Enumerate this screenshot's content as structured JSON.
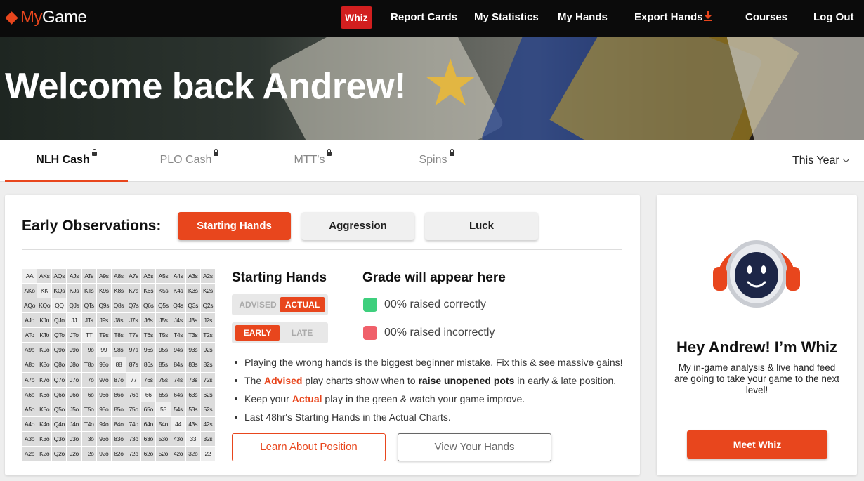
{
  "brand": {
    "logo_mark": "diamond-icon",
    "name_prefix": "My",
    "name_suffix": "Game",
    "accent_color": "#e8461d"
  },
  "nav": {
    "whiz": "Whiz",
    "report_cards": "Report Cards",
    "my_statistics": "My Statistics",
    "my_hands": "My Hands",
    "export_hands": "Export Hands",
    "export_icon": "download-icon",
    "courses": "Courses",
    "log_out": "Log Out"
  },
  "hero": {
    "title": "Welcome back Andrew!"
  },
  "tabs": [
    {
      "label": "NLH Cash",
      "active": true,
      "locked": true
    },
    {
      "label": "PLO Cash",
      "active": false,
      "locked": true
    },
    {
      "label": "MTT's",
      "active": false,
      "locked": true
    },
    {
      "label": "Spins",
      "active": false,
      "locked": true
    }
  ],
  "period": {
    "selected": "This Year"
  },
  "observations": {
    "title": "Early Observations:",
    "buttons": [
      "Starting Hands",
      "Aggression",
      "Luck"
    ],
    "active_button": "Starting Hands"
  },
  "hand_grid": [
    [
      "AA",
      "AKs",
      "AQs",
      "AJs",
      "ATs",
      "A9s",
      "A8s",
      "A7s",
      "A6s",
      "A5s",
      "A4s",
      "A3s",
      "A2s"
    ],
    [
      "AKo",
      "KK",
      "KQs",
      "KJs",
      "KTs",
      "K9s",
      "K8s",
      "K7s",
      "K6s",
      "K5s",
      "K4s",
      "K3s",
      "K2s"
    ],
    [
      "AQo",
      "KQo",
      "QQ",
      "QJs",
      "QTs",
      "Q9s",
      "Q8s",
      "Q7s",
      "Q6s",
      "Q5s",
      "Q4s",
      "Q3s",
      "Q2s"
    ],
    [
      "AJo",
      "KJo",
      "QJo",
      "JJ",
      "JTs",
      "J9s",
      "J8s",
      "J7s",
      "J6s",
      "J5s",
      "J4s",
      "J3s",
      "J2s"
    ],
    [
      "ATo",
      "KTo",
      "QTo",
      "JTo",
      "TT",
      "T9s",
      "T8s",
      "T7s",
      "T6s",
      "T5s",
      "T4s",
      "T3s",
      "T2s"
    ],
    [
      "A9o",
      "K9o",
      "Q9o",
      "J9o",
      "T9o",
      "99",
      "98s",
      "97s",
      "96s",
      "95s",
      "94s",
      "93s",
      "92s"
    ],
    [
      "A8o",
      "K8o",
      "Q8o",
      "J8o",
      "T8o",
      "98o",
      "88",
      "87s",
      "86s",
      "85s",
      "84s",
      "83s",
      "82s"
    ],
    [
      "A7o",
      "K7o",
      "Q7o",
      "J7o",
      "T7o",
      "97o",
      "87o",
      "77",
      "76s",
      "75s",
      "74s",
      "73s",
      "72s"
    ],
    [
      "A6o",
      "K6o",
      "Q6o",
      "J6o",
      "T6o",
      "96o",
      "86o",
      "76o",
      "66",
      "65s",
      "64s",
      "63s",
      "62s"
    ],
    [
      "A5o",
      "K5o",
      "Q5o",
      "J5o",
      "T5o",
      "95o",
      "85o",
      "75o",
      "65o",
      "55",
      "54s",
      "53s",
      "52s"
    ],
    [
      "A4o",
      "K4o",
      "Q4o",
      "J4o",
      "T4o",
      "94o",
      "84o",
      "74o",
      "64o",
      "54o",
      "44",
      "43s",
      "42s"
    ],
    [
      "A3o",
      "K3o",
      "Q3o",
      "J3o",
      "T3o",
      "93o",
      "83o",
      "73o",
      "63o",
      "53o",
      "43o",
      "33",
      "32s"
    ],
    [
      "A2o",
      "K2o",
      "Q2o",
      "J2o",
      "T2o",
      "92o",
      "82o",
      "72o",
      "62o",
      "52o",
      "42o",
      "32o",
      "22"
    ]
  ],
  "starting_hands": {
    "title": "Starting Hands",
    "toggle_mode": {
      "options": [
        "ADVISED",
        "ACTUAL"
      ],
      "selected": "ACTUAL"
    },
    "toggle_position": {
      "options": [
        "EARLY",
        "LATE"
      ],
      "selected": "EARLY"
    }
  },
  "grade": {
    "title": "Grade will appear here",
    "correct": {
      "text": "00% raised correctly",
      "color": "#3ecf7d"
    },
    "incorrect": {
      "text": "00% raised incorrectly",
      "color": "#f0606a"
    }
  },
  "bullets": {
    "b1": "Playing the wrong hands is the biggest beginner mistake. Fix this & see massive gains!",
    "b2_pre": "The ",
    "b2_hl": "Advised",
    "b2_mid": " play charts show when to ",
    "b2_bold": "raise unopened pots",
    "b2_post": " in early & late position.",
    "b3_pre": "Keep your ",
    "b3_hl": "Actual",
    "b3_post": " play in the green & watch your game improve.",
    "b4": "Last 48hr's Starting Hands in the Actual Charts."
  },
  "actions": {
    "learn": "Learn About Position",
    "view": "View Your Hands"
  },
  "whiz": {
    "avatar_icon": "robot-headphones-icon",
    "title": "Hey Andrew! I’m Whiz",
    "subtitle": "My in-game analysis & live hand feed are going to take your game to the next level!",
    "button": "Meet Whiz"
  }
}
